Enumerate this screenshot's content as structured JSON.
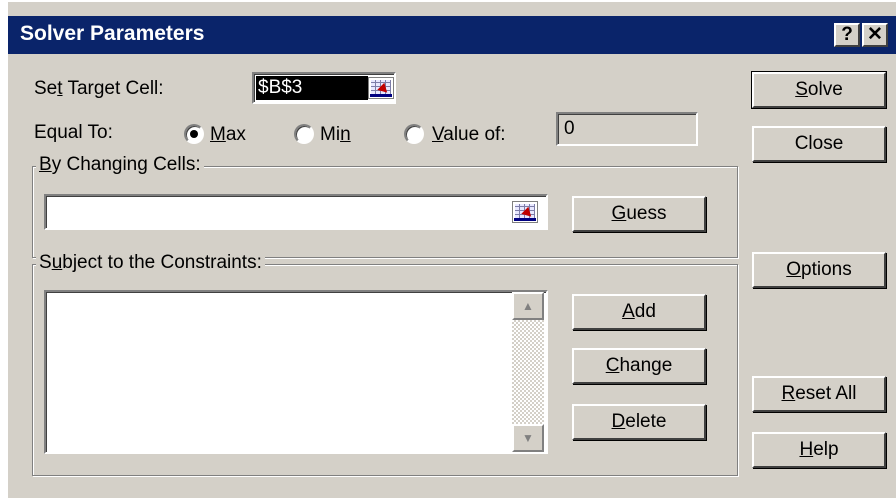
{
  "window": {
    "title": "Solver Parameters",
    "help_btn": "?",
    "close_btn": "✕"
  },
  "target": {
    "label_pre": "Se",
    "label_u": "t",
    "label_post": " Target Cell:",
    "value": "$B$3"
  },
  "equal_to": {
    "label": "Equal To:",
    "max_u": "M",
    "max_rest": "ax",
    "min_pre": "Mi",
    "min_u": "n",
    "value_u": "V",
    "value_rest": "alue of:",
    "value_field": "0",
    "selected": "max"
  },
  "changing": {
    "label_u": "B",
    "label_rest": "y Changing Cells:",
    "value": ""
  },
  "constraints": {
    "label_pre": "S",
    "label_u": "u",
    "label_rest": "bject to the Constraints:",
    "items": []
  },
  "buttons": {
    "solve_u": "S",
    "solve_rest": "olve",
    "close": "Close",
    "guess_u": "G",
    "guess_rest": "uess",
    "options_u": "O",
    "options_rest": "ptions",
    "add_u": "A",
    "add_rest": "dd",
    "change_u": "C",
    "change_rest": "hange",
    "delete_u": "D",
    "delete_rest": "elete",
    "reset_pre": "",
    "reset_u": "R",
    "reset_rest": "eset All",
    "help_u": "H",
    "help_rest": "elp"
  },
  "colors": {
    "titlebar": "#0a246a",
    "face": "#d4d0c8"
  }
}
